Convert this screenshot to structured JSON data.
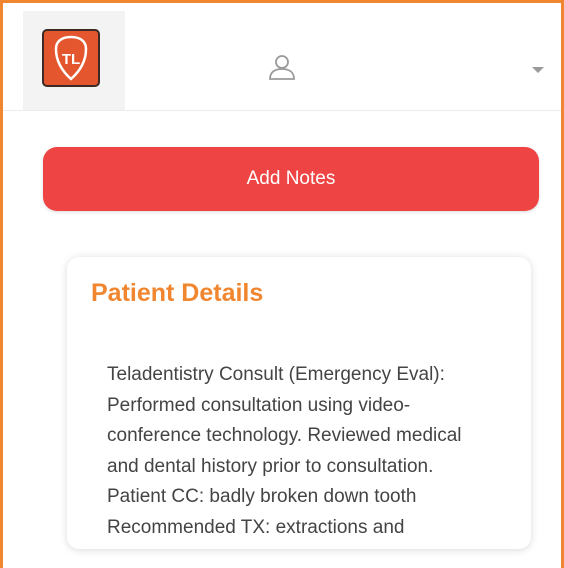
{
  "header": {
    "logo_initials": "TL",
    "icons": [
      "user-icon",
      "chevron-down-icon"
    ]
  },
  "actions": {
    "add_notes_label": "Add Notes"
  },
  "patient_details": {
    "title": "Patient Details",
    "lines": [
      "Teladentistry Consult (Emergency Eval):",
      "Performed consultation using video-",
      "conference technology. Reviewed medical",
      "and dental history prior to consultation.",
      "Patient CC: badly broken down tooth",
      "Recommended TX:  extractions and"
    ]
  },
  "colors": {
    "accent": "#f0862f",
    "button": "#ee4444",
    "text": "#444444"
  }
}
